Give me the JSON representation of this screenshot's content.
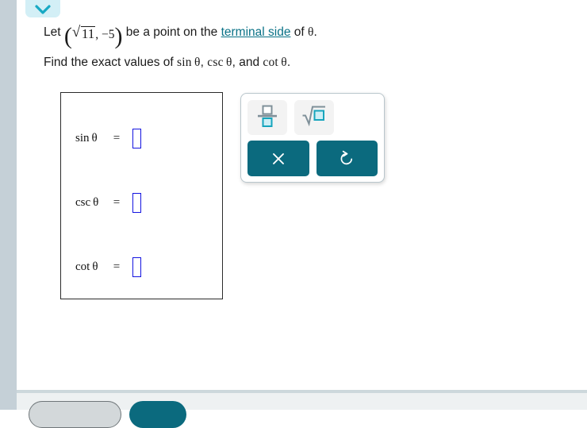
{
  "window": {
    "collapse_icon": "chevron-down-icon"
  },
  "problem": {
    "line1_prefix": "Let ",
    "point_open": "(",
    "point_radical_sign": "√",
    "point_radicand": "11",
    "point_comma": ",",
    "point_y": "−5",
    "point_close": ")",
    "line1_mid": " be a point on the ",
    "terminal_side_link": "terminal side",
    "line1_suffix_pre": " of ",
    "theta": "θ",
    "line1_period": ".",
    "line2_prefix": "Find the exact values of ",
    "fn_sin": "sin",
    "fn_csc": "csc",
    "fn_cot": "cot",
    "line2_sep1": ", ",
    "line2_sep2": ", and ",
    "line2_period": "."
  },
  "answer_box": {
    "rows": [
      {
        "label": "sin θ",
        "equals": "=",
        "value": "",
        "name": "sin-theta"
      },
      {
        "label": "csc θ",
        "equals": "=",
        "value": "",
        "name": "csc-theta"
      },
      {
        "label": "cot θ",
        "equals": "=",
        "value": "",
        "name": "cot-theta"
      }
    ]
  },
  "palette": {
    "fraction_icon": "fraction-template-icon",
    "sqrt_icon": "square-root-template-icon",
    "clear_icon": "close-x-icon",
    "undo_icon": "undo-reset-icon"
  },
  "footer": {
    "secondary_label": "",
    "primary_label": ""
  },
  "colors": {
    "teal": "#0b6a7e",
    "link": "#0a7287",
    "chevron_pill_bg": "#d3eff6",
    "rail": "#c5d0d7",
    "input_border": "#1414e0",
    "icon_accent": "#17a5bd",
    "icon_gray": "#7f9099"
  }
}
